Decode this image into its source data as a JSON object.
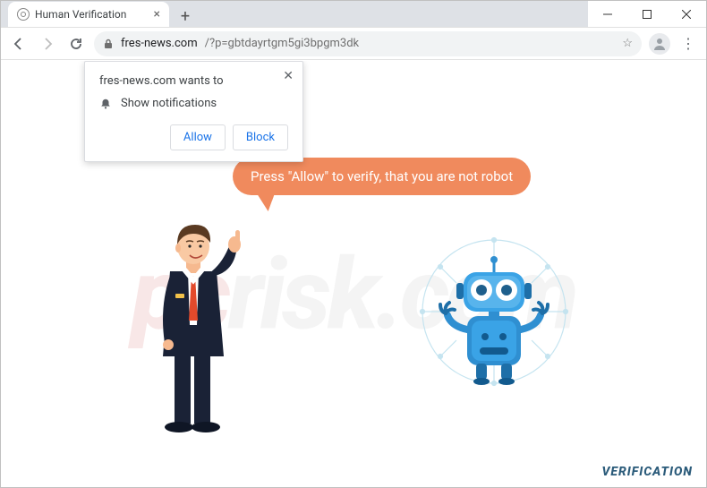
{
  "window": {
    "tab_title": "Human Verification",
    "minimize": "—",
    "maximize": "□",
    "close": "✕"
  },
  "toolbar": {
    "url_host": "fres-news.com",
    "url_path": "/?p=gbtdayrtgm5gi3bpgm3dk"
  },
  "permission": {
    "title": "fres-news.com wants to",
    "row_label": "Show notifications",
    "allow": "Allow",
    "block": "Block"
  },
  "page": {
    "bubble_text": "Press \"Allow\" to verify, that you are not robot",
    "verification_label": "VERIFICATION",
    "watermark_left": "pc",
    "watermark_right": "risk.com"
  }
}
